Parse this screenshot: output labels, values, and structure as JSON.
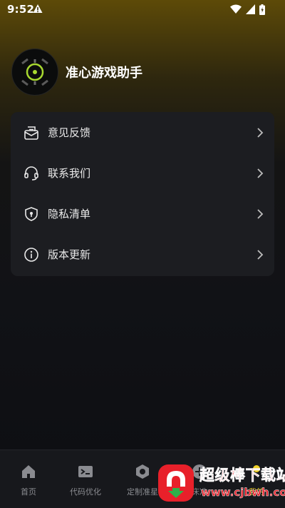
{
  "status_bar": {
    "time": "9:52",
    "icons": [
      "alert-icon",
      "wifi-icon",
      "signal-icon",
      "battery-icon"
    ]
  },
  "profile": {
    "avatar_icon": "crosshair-logo-icon",
    "app_name": "准心游戏助手"
  },
  "menu": {
    "items": [
      {
        "label": "意见反馈",
        "icon": "feedback-mail-icon"
      },
      {
        "label": "联系我们",
        "icon": "headset-icon"
      },
      {
        "label": "隐私清单",
        "icon": "shield-icon"
      },
      {
        "label": "版本更新",
        "icon": "info-icon"
      }
    ]
  },
  "tabbar": {
    "tabs": [
      {
        "label": "首页",
        "icon": "home-icon",
        "active": false
      },
      {
        "label": "代码优化",
        "icon": "terminal-icon",
        "active": false
      },
      {
        "label": "定制准星",
        "icon": "hexagon-nut-icon",
        "active": false
      },
      {
        "label": "床准",
        "icon": "plus-circle-icon",
        "active": false
      },
      {
        "label": "我的",
        "icon": "profile-icon",
        "active": true
      }
    ]
  },
  "watermark": {
    "title": "超级棒下载站",
    "url": "www.cjbwh.com"
  },
  "colors": {
    "accent": "#f0d027",
    "card_bg": "#1c1d21",
    "tab_inactive": "#8a8b90",
    "header_gradient_top": "#5d4a08",
    "watermark_red": "#e8202a"
  }
}
